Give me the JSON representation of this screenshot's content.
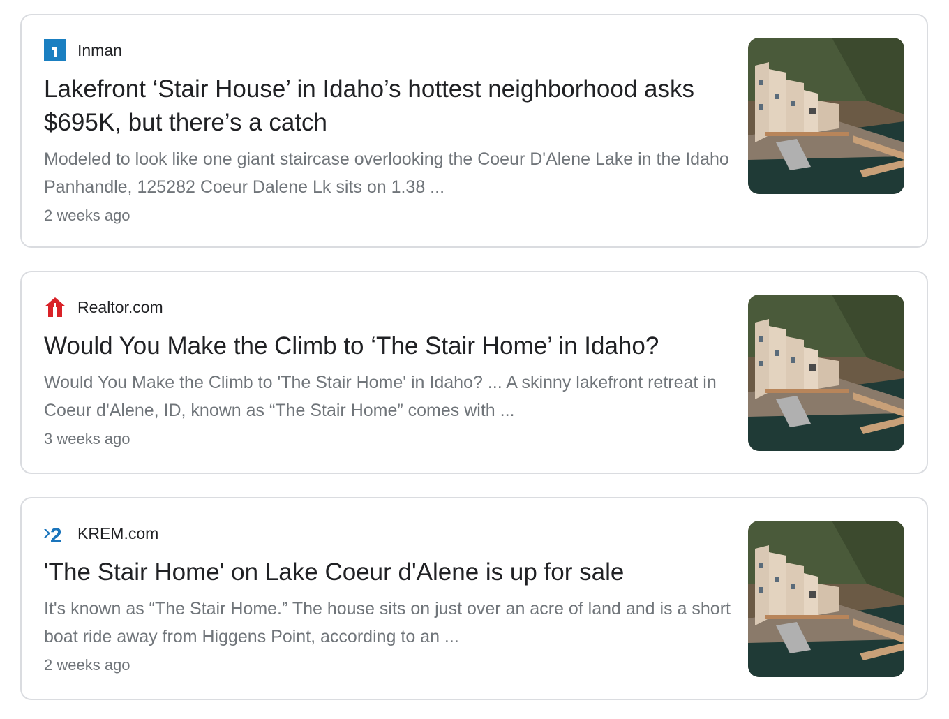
{
  "articles": [
    {
      "source": "Inman",
      "source_icon": "inman-logo-icon",
      "title": "Lakefront ‘Stair House’ in Idaho’s hottest neighborhood asks $695K, but there’s a catch",
      "snippet": "Modeled to look like one giant staircase overlooking the Coeur D'Alene Lake in the Idaho Panhandle, 125282 Coeur Dalene Lk sits on 1.38 ...",
      "time": "2 weeks ago",
      "thumbnail": "stair-house-photo"
    },
    {
      "source": "Realtor.com",
      "source_icon": "realtor-house-logo-icon",
      "title": "Would You Make the Climb to ‘The Stair Home’ in Idaho?",
      "snippet": "Would You Make the Climb to 'The Stair Home' in Idaho? ... A skinny lakefront retreat in Coeur d'Alene, ID, known as “The Stair Home” comes with ...",
      "time": "3 weeks ago",
      "thumbnail": "stair-house-photo"
    },
    {
      "source": "KREM.com",
      "source_icon": "krem-2-logo-icon",
      "title": "'The Stair Home' on Lake Coeur d'Alene is up for sale",
      "snippet": "It's known as “The Stair Home.” The house sits on just over an acre of land and is a short boat ride away from Higgens Point, according to an ...",
      "time": "2 weeks ago",
      "thumbnail": "stair-house-photo"
    }
  ],
  "colors": {
    "inman_blue": "#1a7fc1",
    "realtor_red": "#d92228",
    "krem_blue": "#1b75bc",
    "title": "#202124",
    "snippet": "#70757a",
    "border": "#dadce0"
  }
}
